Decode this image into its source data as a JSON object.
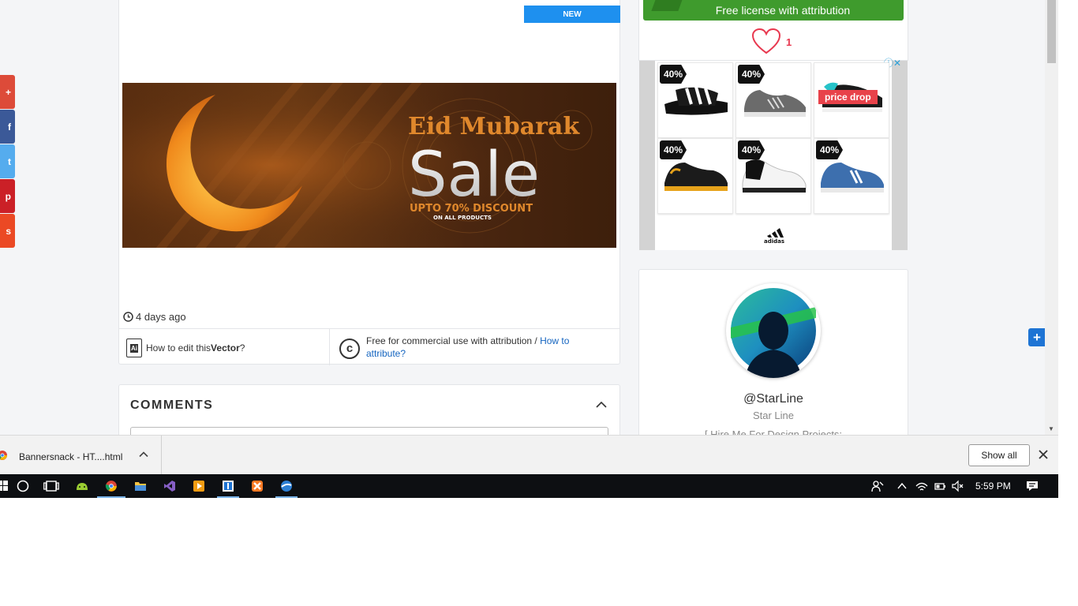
{
  "main": {
    "new_badge": "NEW",
    "banner": {
      "title": "Eid Mubarak",
      "headline": "Sale",
      "discount": "UPTO 70% DISCOUNT",
      "subline": "ON ALL PRODUCTS"
    },
    "time_ago": "4 days ago",
    "edit_prefix": "How to edit this ",
    "edit_type": "Vector",
    "edit_suffix": "?",
    "license_text": "Free for commercial use with attribution / ",
    "attribute_link": "How to attribute?"
  },
  "comments": {
    "title": "COMMENTS"
  },
  "sidebar": {
    "license_button": "Free license with attribution",
    "like_count": "1",
    "ad": {
      "discount_tag": "40%",
      "price_drop": "price drop",
      "brand": "adidas"
    },
    "profile": {
      "handle": "@StarLine",
      "name": "Star Line",
      "bio": "[ Hire Me For Design Projects:"
    }
  },
  "download_bar": {
    "file_name": "Bannersnack - HT....html",
    "show_all": "Show all"
  },
  "taskbar": {
    "time": "5:59 PM"
  },
  "colors": {
    "brand_blue": "#1e90ef",
    "license_green": "#3f9b2d",
    "like_red": "#e8384f",
    "share_gplus": "#dd4b39",
    "share_facebook": "#3b5998",
    "share_twitter": "#55acee",
    "share_pinterest": "#cb2027",
    "share_stumble": "#eb4924"
  },
  "icons": {
    "share": [
      "google-plus-icon",
      "facebook-icon",
      "twitter-icon",
      "pinterest-icon",
      "stumbleupon-icon"
    ],
    "taskbar": [
      "windows-start-icon",
      "cortana-icon",
      "task-view-icon",
      "android-studio-icon",
      "chrome-icon",
      "file-explorer-icon",
      "visual-studio-icon",
      "media-player-icon",
      "app-icon",
      "xampp-icon",
      "browser-icon"
    ]
  }
}
